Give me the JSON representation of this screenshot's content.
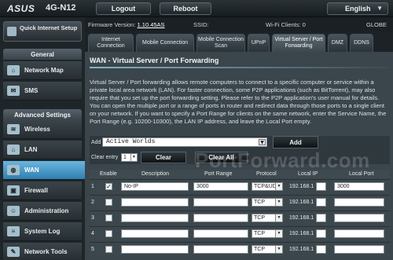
{
  "header": {
    "brand": "ASUS",
    "model": "4G-N12",
    "logout_label": "Logout",
    "reboot_label": "Reboot",
    "language": "English"
  },
  "status": {
    "firmware_label": "Firmware Version:",
    "firmware_value": "1.10.45AS",
    "ssid_label": "SSID:",
    "wifi_label": "Wi-Fi Clients: 0",
    "globe_label": "GLOBE"
  },
  "nav": {
    "qis_label": "Quick Internet Setup",
    "general_header": "General",
    "advanced_header": "Advanced Settings",
    "items": [
      {
        "label": "Network Map"
      },
      {
        "label": "SMS"
      },
      {
        "label": "Wireless"
      },
      {
        "label": "LAN"
      },
      {
        "label": "WAN"
      },
      {
        "label": "Firewall"
      },
      {
        "label": "Administration"
      },
      {
        "label": "System Log"
      },
      {
        "label": "Network Tools"
      }
    ]
  },
  "tabs": [
    {
      "label": "Internet Connection"
    },
    {
      "label": "Mobile Connection"
    },
    {
      "label": "Mobile Connection Scan"
    },
    {
      "label": "UPnP"
    },
    {
      "label": "Virtual Server / Port Forwarding"
    },
    {
      "label": "DMZ"
    },
    {
      "label": "DDNS"
    }
  ],
  "page": {
    "title": "WAN - Virtual Server / Port Forwarding",
    "description": "Virtual Server / Port forwarding allows remote computers to connect to a specific computer or service within a private local area network (LAN). For faster connection, some P2P applications (such as BitTorrent), may also require that you set up the port forwarding setting. Please refer to the P2P application's user manual for details. You can open the multiple port or a range of ports in router and redirect data through those ports to a single client on your network. If you want to specify a Port Range for clients on the same network, enter the Service Name, the Port Range (e.g. 10200-10300), the LAN IP address, and leave the Local Port empty."
  },
  "controls": {
    "add_label": "Add",
    "add_select_value": "Active Worlds",
    "add_button": "Add",
    "clear_label": "Clear entry",
    "clear_select_value": "1",
    "clear_button": "Clear",
    "clear_all_button": "Clear All"
  },
  "watermark": "PortForward.com",
  "table": {
    "headers": [
      "Enable",
      "Description",
      "Port Range",
      "Protocol",
      "Local IP",
      "Local Port"
    ],
    "rows": [
      {
        "num": "1",
        "enabled": "✓",
        "description": "No-IP",
        "port_range": "3000",
        "protocol": "TCP&UDP",
        "ip": "192.168.1",
        "local_port": "3000"
      },
      {
        "num": "2",
        "enabled": "",
        "description": "",
        "port_range": "",
        "protocol": "TCP",
        "ip": "192.168.1",
        "local_port": ""
      },
      {
        "num": "3",
        "enabled": "",
        "description": "",
        "port_range": "",
        "protocol": "TCP",
        "ip": "192.168.1",
        "local_port": ""
      },
      {
        "num": "4",
        "enabled": "",
        "description": "",
        "port_range": "",
        "protocol": "TCP",
        "ip": "192.168.1",
        "local_port": ""
      },
      {
        "num": "5",
        "enabled": "",
        "description": "",
        "port_range": "",
        "protocol": "TCP",
        "ip": "192.168.1",
        "local_port": ""
      }
    ]
  }
}
